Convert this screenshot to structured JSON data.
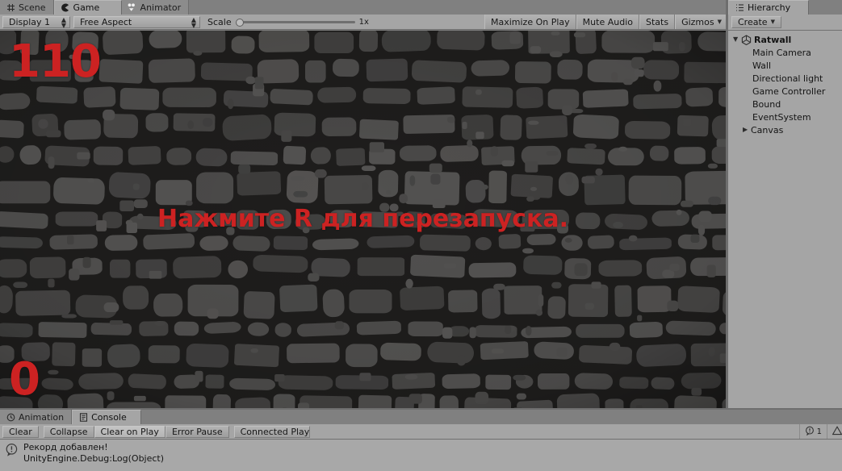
{
  "window": {
    "game_tabs": [
      {
        "label": "Scene",
        "icon": "grid-icon",
        "active": false
      },
      {
        "label": "Game",
        "icon": "game-pacman-icon",
        "active": true
      },
      {
        "label": "Animator",
        "icon": "animator-icon",
        "active": false
      }
    ],
    "game_toolbar": {
      "display": "Display 1",
      "aspect": "Free Aspect",
      "scale_label": "Scale",
      "scale_value": "1x",
      "maximize_on_play": "Maximize On Play",
      "mute_audio": "Mute Audio",
      "stats": "Stats",
      "gizmos": "Gizmos"
    },
    "game_render": {
      "score_top": "110",
      "score_bottom": "0",
      "restart_message": "Нажмите R для перезапуска.",
      "text_color": "#cc2222",
      "stone_color": "#4b4a49",
      "mortar_color": "#1e1d1c"
    },
    "hierarchy": {
      "tab_label": "Hierarchy",
      "tab_icon": "hierarchy-list-icon",
      "create_label": "Create",
      "root": {
        "label": "Ratwall",
        "icon": "unity-logo-icon",
        "expanded": true
      },
      "children": [
        {
          "label": "Main Camera",
          "expandable": false
        },
        {
          "label": "Wall",
          "expandable": false
        },
        {
          "label": "Directional light",
          "expandable": false
        },
        {
          "label": "Game Controller",
          "expandable": false
        },
        {
          "label": "Bound",
          "expandable": false
        },
        {
          "label": "EventSystem",
          "expandable": false
        },
        {
          "label": "Canvas",
          "expandable": true
        }
      ]
    },
    "console_tabs": [
      {
        "label": "Animation",
        "icon": "clock-icon",
        "active": false
      },
      {
        "label": "Console",
        "icon": "console-icon",
        "active": true
      }
    ],
    "console_toolbar": {
      "clear": "Clear",
      "collapse": "Collapse",
      "clear_on_play": "Clear on Play",
      "error_pause": "Error Pause",
      "connected_player": "Connected Playe",
      "info_count": "1"
    },
    "console_log": {
      "icon": "info-icon",
      "message": "Рекорд добавлен!",
      "stack": "UnityEngine.Debug:Log(Object)"
    }
  }
}
